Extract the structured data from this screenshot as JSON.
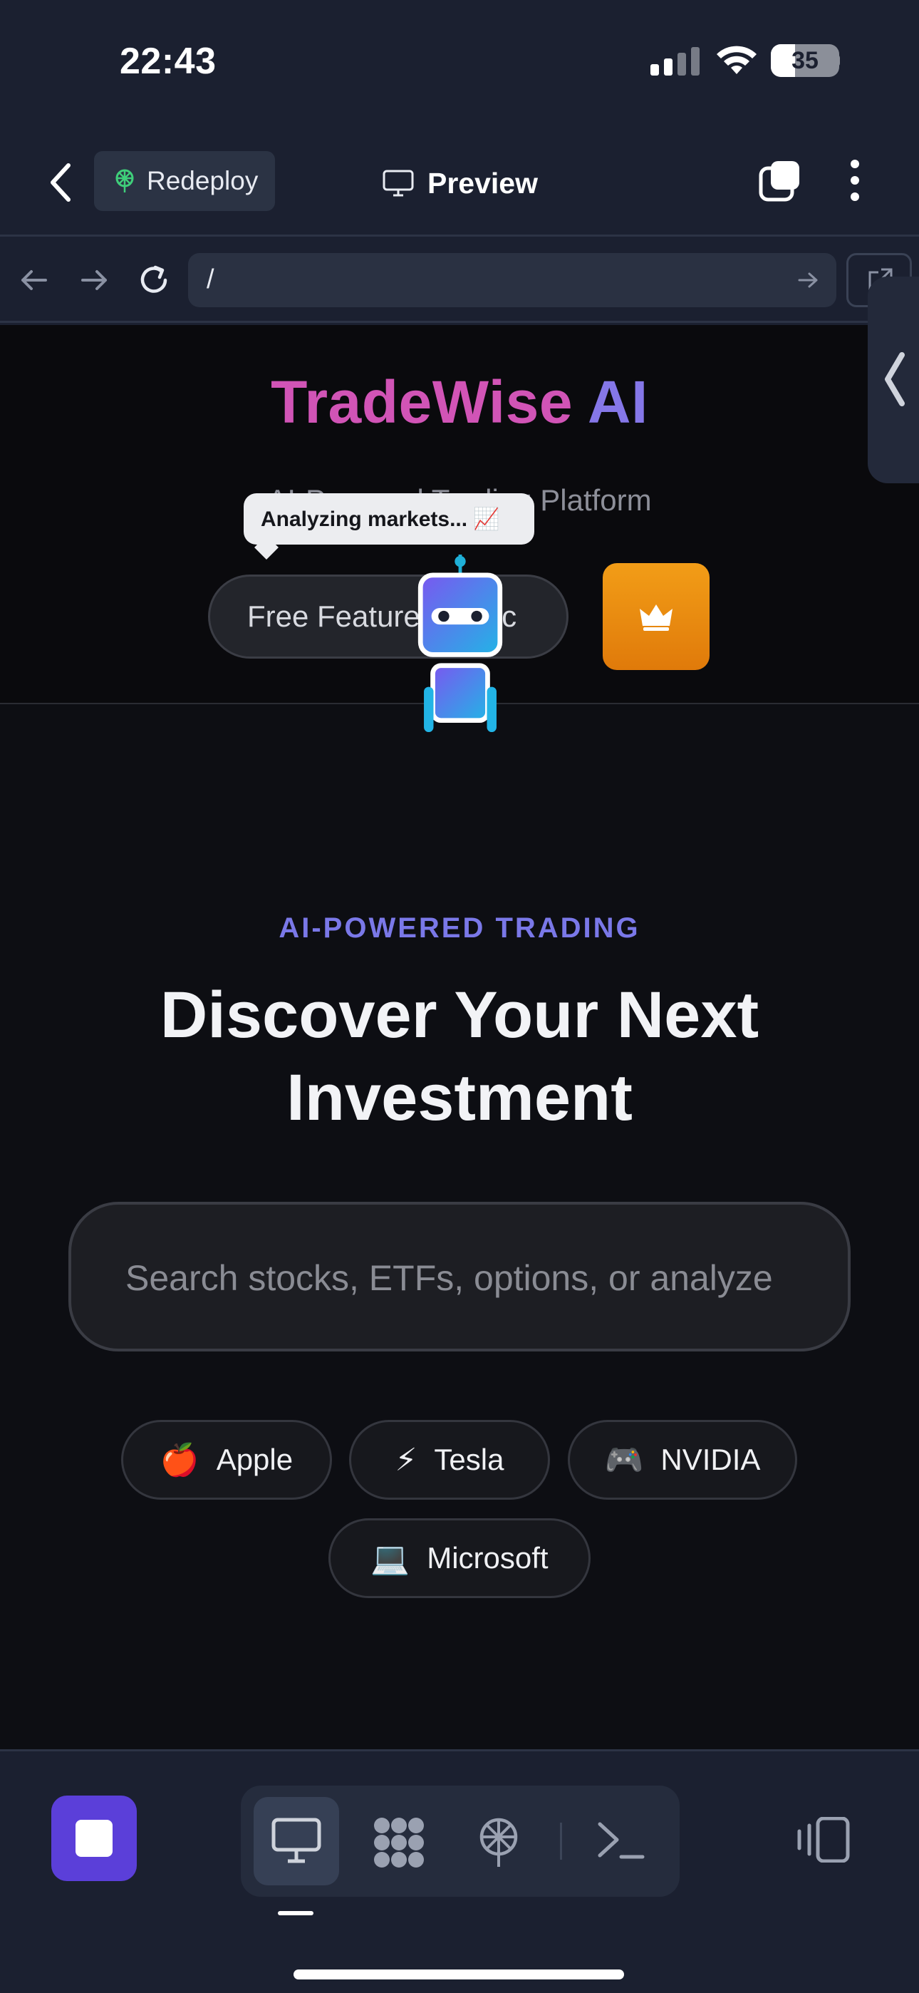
{
  "status_bar": {
    "time": "22:43",
    "battery": "35"
  },
  "header": {
    "redeploy_label": "Redeploy",
    "preview_label": "Preview"
  },
  "browser": {
    "url": "/"
  },
  "site": {
    "brand_part1": "TradeWise",
    "brand_part2": "AI",
    "subtitle": "AI-Powered Trading Platform",
    "tier_label": "Free Features Basic",
    "bubble_text": "Analyzing markets... 📈",
    "kicker": "AI-POWERED TRADING",
    "headline_line1": "Discover Your Next",
    "headline_line2": "Investment",
    "search_placeholder": "Search stocks, ETFs, options, or analyze",
    "chips": [
      {
        "emoji": "🍎",
        "label": "Apple"
      },
      {
        "emoji": "⚡",
        "label": "Tesla"
      },
      {
        "emoji": "🎮",
        "label": "NVIDIA"
      },
      {
        "emoji": "💻",
        "label": "Microsoft"
      }
    ]
  },
  "toolbar": {
    "icons": [
      "monitor-icon",
      "apps-grid-icon",
      "deploy-icon",
      "terminal-icon"
    ],
    "active": "monitor-icon"
  },
  "colors": {
    "brand_pink": "#d154b6",
    "brand_violet": "#8577e8",
    "accent_purple": "#5b3fd9",
    "crown_orange": "#f29d17"
  }
}
